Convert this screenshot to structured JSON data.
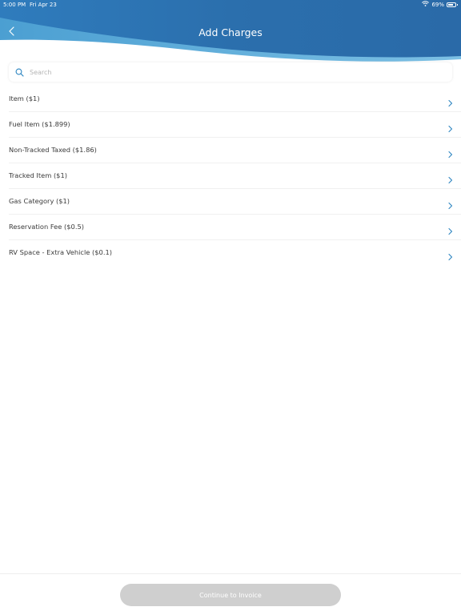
{
  "status_bar": {
    "time": "5:00 PM",
    "date": "Fri Apr 23",
    "battery_percent": "69%",
    "battery_level": 0.69
  },
  "nav": {
    "title": "Add Charges",
    "back_icon": "chevron-left-icon"
  },
  "search": {
    "placeholder": "Search",
    "value": "",
    "icon": "search-icon"
  },
  "charges": [
    {
      "label": "Item ($1)"
    },
    {
      "label": "Fuel Item ($1.899)"
    },
    {
      "label": "Non-Tracked Taxed ($1.86)"
    },
    {
      "label": "Tracked Item ($1)"
    },
    {
      "label": "Gas Category ($1)"
    },
    {
      "label": "Reservation Fee ($0.5)"
    },
    {
      "label": "RV Space - Extra Vehicle ($0.1)"
    }
  ],
  "footer": {
    "continue_label": "Continue to Invoice",
    "continue_enabled": false
  },
  "colors": {
    "header_dark": "#2a6cab",
    "header_light": "#5aa9d8",
    "accent": "#2e86c1",
    "button_disabled": "#cfcfcf"
  }
}
